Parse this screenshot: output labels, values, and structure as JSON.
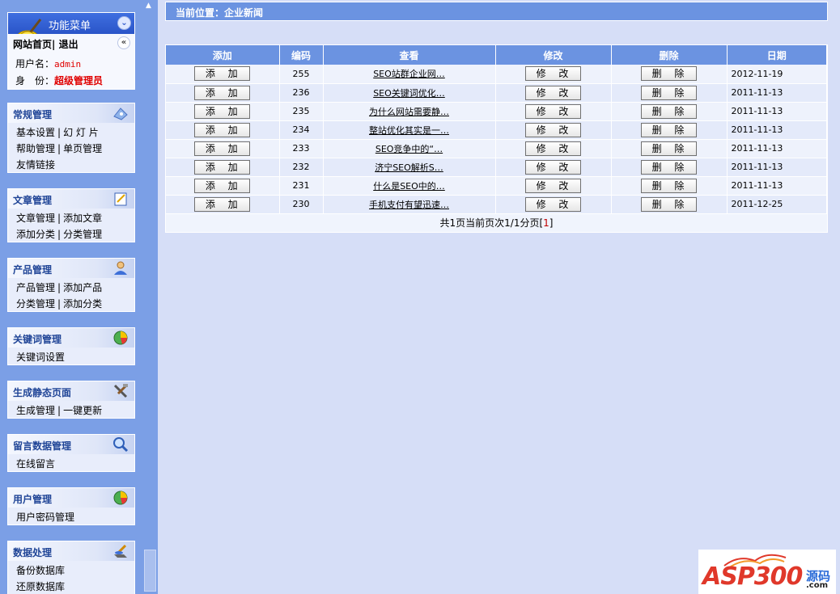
{
  "menu": {
    "title": "功能菜单",
    "nav_home": "网站首页",
    "nav_sep": "|",
    "nav_logout": "退出",
    "username_label": "用户名：",
    "username": "admin",
    "identity_label": "身　份：",
    "identity": "超级管理员"
  },
  "panels": [
    {
      "title": "常规管理",
      "icon": "settings-icon",
      "rows": [
        [
          "基本设置",
          "幻 灯 片"
        ],
        [
          "帮助管理",
          "单页管理"
        ],
        [
          "友情链接"
        ]
      ]
    },
    {
      "title": "文章管理",
      "icon": "edit-icon",
      "rows": [
        [
          "文章管理",
          "添加文章"
        ],
        [
          "添加分类",
          "分类管理"
        ]
      ]
    },
    {
      "title": "产品管理",
      "icon": "product-icon",
      "rows": [
        [
          "产品管理",
          "添加产品"
        ],
        [
          "分类管理",
          "添加分类"
        ]
      ]
    },
    {
      "title": "关键词管理",
      "icon": "chart-icon",
      "rows": [
        [
          "关键词设置"
        ]
      ]
    },
    {
      "title": "生成静态页面",
      "icon": "tools-icon",
      "rows": [
        [
          "生成管理",
          "一键更新"
        ]
      ]
    },
    {
      "title": "留言数据管理",
      "icon": "magnifier-icon",
      "rows": [
        [
          "在线留言"
        ]
      ]
    },
    {
      "title": "用户管理",
      "icon": "chart-icon",
      "rows": [
        [
          "用户密码管理"
        ]
      ]
    },
    {
      "title": "数据处理",
      "icon": "database-icon",
      "rows": [
        [
          "备份数据库"
        ],
        [
          "还原数据库"
        ]
      ]
    }
  ],
  "breadcrumb": "当前位置：企业新闻",
  "table": {
    "headers": [
      "添加",
      "编码",
      "查看",
      "修改",
      "删除",
      "日期"
    ],
    "add_label": "添 加",
    "edit_label": "修 改",
    "delete_label": "删 除",
    "rows": [
      {
        "id": "255",
        "title": "SEO站群企业网…",
        "date": "2012-11-19"
      },
      {
        "id": "236",
        "title": "SEO关键词优化…",
        "date": "2011-11-13"
      },
      {
        "id": "235",
        "title": "为什么网站需要静…",
        "date": "2011-11-13"
      },
      {
        "id": "234",
        "title": "整站优化其实是一…",
        "date": "2011-11-13"
      },
      {
        "id": "233",
        "title": "SEO竞争中的“…",
        "date": "2011-11-13"
      },
      {
        "id": "232",
        "title": "济宁SEO解析S…",
        "date": "2011-11-13"
      },
      {
        "id": "231",
        "title": "什么是SEO中的…",
        "date": "2011-11-13"
      },
      {
        "id": "230",
        "title": "手机支付有望迅速…",
        "date": "2011-12-25"
      }
    ]
  },
  "pager": {
    "text": "共1页当前页次1/1分页[",
    "current": "1",
    "close": "]"
  },
  "watermark": {
    "brand": "ASP300",
    "code": "源码",
    "domain": ".com"
  },
  "colors": {
    "sidebar": "#7b9fe6",
    "header_blue": "#6b93e1",
    "content_bg": "#d6def7",
    "highlight_red": "#e00000"
  }
}
